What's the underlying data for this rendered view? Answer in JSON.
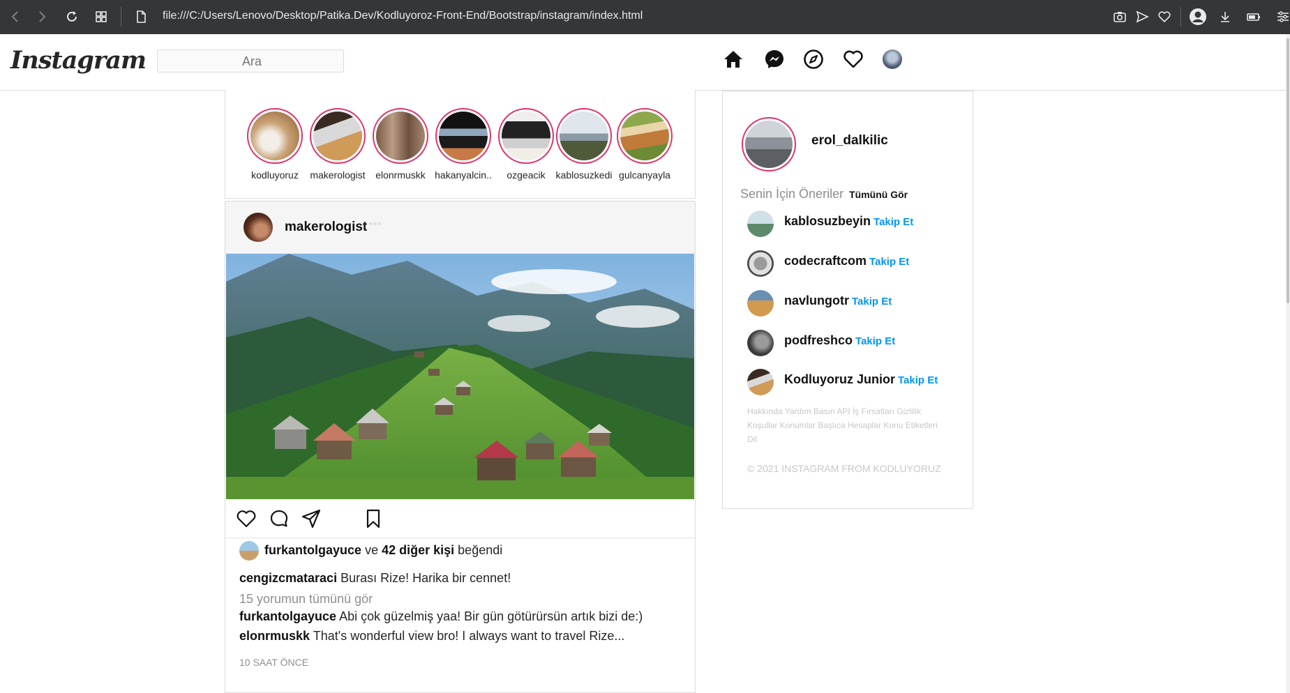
{
  "browser": {
    "url": "file:///C:/Users/Lenovo/Desktop/Patika.Dev/Kodluyoroz-Front-End/Bootstrap/instagram/index.html"
  },
  "header": {
    "logo": "Instagram",
    "search_placeholder": "Ara"
  },
  "stories": [
    {
      "name": "kodluyoruz"
    },
    {
      "name": "makerologist"
    },
    {
      "name": "elonrmuskk"
    },
    {
      "name": "hakanyalcin.."
    },
    {
      "name": "ozgeacik"
    },
    {
      "name": "kablosuzkedi"
    },
    {
      "name": "gulcanyayla"
    }
  ],
  "post": {
    "username": "makerologist",
    "more": "•••",
    "likes": {
      "user": "furkantolgayuce",
      "connector": "ve",
      "others": "42 diğer kişi",
      "suffix": "beğendi"
    },
    "caption": {
      "user": "cengizcmataraci",
      "text": "Burası Rize! Harika bir cennet!"
    },
    "view_all": "15 yorumun tümünü gör",
    "comments": [
      {
        "user": "furkantolgayuce",
        "text": "Abi çok güzelmiş yaa! Bir gün götürürsün artık bizi de:)"
      },
      {
        "user": "elonrmuskk",
        "text": "That's wonderful view bro! I always want to travel Rize..."
      }
    ],
    "time": "10 SAAT ÖNCE"
  },
  "sidebar": {
    "profile_name": "erol_dalkilic",
    "suggestions_title": "Senin İçin Öneriler",
    "see_all": "Tümünü Gör",
    "follow_label": "Takip Et",
    "suggestions": [
      {
        "name": "kablosuzbeyin"
      },
      {
        "name": "codecraftcom"
      },
      {
        "name": "navlungotr"
      },
      {
        "name": "podfreshco"
      },
      {
        "name": "Kodluyoruz Junior"
      }
    ],
    "footer_links": "Hakkında Yardım Basın API İş Fırsatları Gizlilik Koşullar Konumlar Başlıca Hesaplar Konu Etiketleri Dil",
    "copyright": "© 2021 INSTAGRAM FROM KODLUYORUZ"
  },
  "colors": {
    "story_ring": "#e1306c",
    "follow": "#0095f6",
    "browser_bar": "#35363a"
  }
}
